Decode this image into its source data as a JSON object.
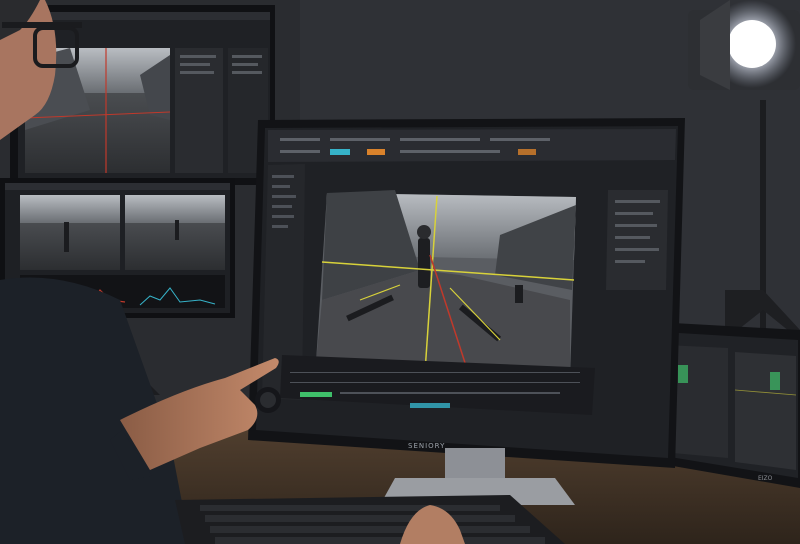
{
  "scene": {
    "description_ui": "",
    "main_monitor": {
      "brand": "SENIORY"
    },
    "right_monitor": {
      "brand": "EIZO"
    }
  },
  "colors": {
    "wall": "#2b2d31",
    "desk": "#4a3a2c",
    "bezel": "#15161a",
    "ui_panel": "#26282c",
    "guide_yellow": "#d8d23a",
    "guide_red": "#c0392b",
    "accent_cyan": "#36b3c9",
    "accent_orange": "#d9822b",
    "accent_green": "#3fbf6a",
    "lamp_glow": "#f4f7ff",
    "skin": "#b07a5e"
  },
  "icons": [
    "studio-light-icon",
    "jog-wheel-icon"
  ]
}
